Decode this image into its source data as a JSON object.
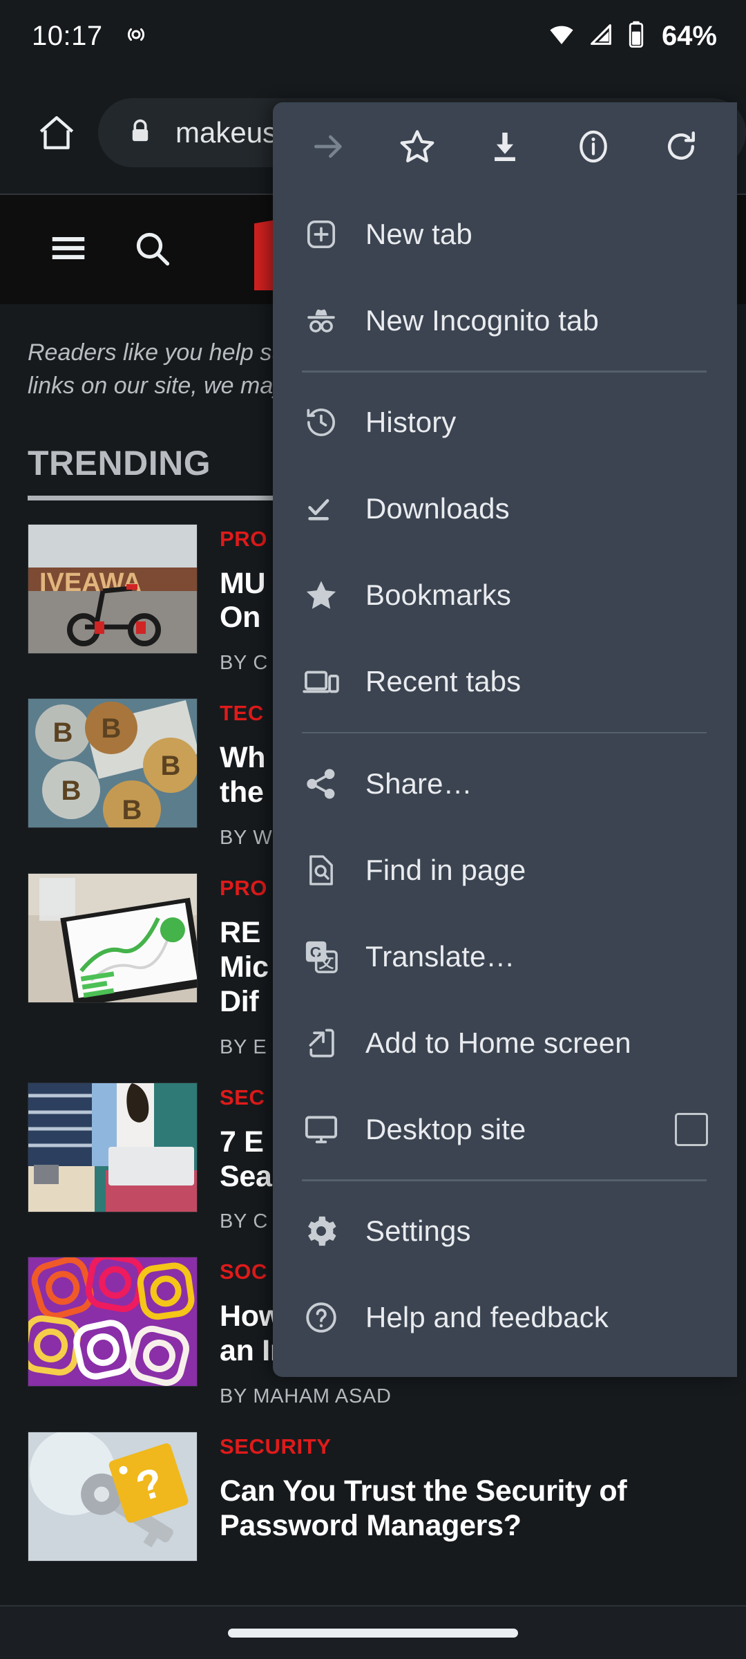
{
  "status_bar": {
    "time": "10:17",
    "hotspot_icon": "cast-hotspot-icon",
    "wifi_icon": "wifi-icon",
    "signal_icon": "cellular-signal-icon",
    "battery_icon": "battery-icon",
    "battery_percent": "64%"
  },
  "toolbar": {
    "home_icon": "home-icon",
    "lock_icon": "lock-icon",
    "url": "makeus"
  },
  "site_header": {
    "menu_icon": "hamburger-menu-icon",
    "search_icon": "search-icon",
    "logo": "makeuseof-logo"
  },
  "page": {
    "disclaimer_line1": "Readers like you help sup",
    "disclaimer_line2": "links on our site, we may",
    "trending_title": "TRENDING",
    "articles": [
      {
        "category": "PRO",
        "headline_line1": "MU",
        "headline_line2": "On",
        "byline": "BY C",
        "thumb": "electric-scooter-giveaway"
      },
      {
        "category": "TEC",
        "headline_line1": "Wh",
        "headline_line2": "the",
        "byline": "BY W",
        "thumb": "bitcoin-coins-cash"
      },
      {
        "category": "PRO",
        "headline_line1": "RE",
        "headline_line2": "Mic",
        "headline_line3": "Dif",
        "byline": "BY E",
        "thumb": "tablet-spreadsheet-chart"
      },
      {
        "category": "SEC",
        "headline_line1": "7 E",
        "headline_line2": "Sea",
        "byline": "BY C",
        "thumb": "people-with-laptop"
      },
      {
        "category": "SOC",
        "headline_line1": "How to Delete a Single Image From",
        "headline_line2": "an Instagram Carousel",
        "byline": "BY MAHAM ASAD",
        "thumb": "instagram-logo-pattern"
      },
      {
        "category": "SECURITY",
        "headline_line1": "Can You Trust the Security of",
        "headline_line2": "Password Managers?",
        "byline": "",
        "thumb": "key-with-question-tag"
      }
    ]
  },
  "menu": {
    "top_actions": [
      {
        "name": "forward-arrow-icon",
        "label": "Forward",
        "disabled": true
      },
      {
        "name": "star-outline-icon",
        "label": "Bookmark",
        "disabled": false
      },
      {
        "name": "download-icon",
        "label": "Download",
        "disabled": false
      },
      {
        "name": "info-circle-icon",
        "label": "Page info",
        "disabled": false
      },
      {
        "name": "reload-icon",
        "label": "Reload",
        "disabled": false
      }
    ],
    "groups": [
      {
        "items": [
          {
            "label": "New tab",
            "icon": "new-tab-icon"
          },
          {
            "label": "New Incognito tab",
            "icon": "incognito-icon"
          }
        ]
      },
      {
        "items": [
          {
            "label": "History",
            "icon": "history-icon"
          },
          {
            "label": "Downloads",
            "icon": "downloads-icon"
          },
          {
            "label": "Bookmarks",
            "icon": "star-filled-icon"
          },
          {
            "label": "Recent tabs",
            "icon": "recent-tabs-icon"
          }
        ]
      },
      {
        "items": [
          {
            "label": "Share…",
            "icon": "share-icon"
          },
          {
            "label": "Find in page",
            "icon": "find-in-page-icon"
          },
          {
            "label": "Translate…",
            "icon": "google-translate-icon"
          },
          {
            "label": "Add to Home screen",
            "icon": "add-to-home-screen-icon"
          },
          {
            "label": "Desktop site",
            "icon": "desktop-monitor-icon",
            "checkbox": false
          }
        ]
      },
      {
        "items": [
          {
            "label": "Settings",
            "icon": "gear-icon"
          },
          {
            "label": "Help and feedback",
            "icon": "help-circle-icon"
          }
        ]
      }
    ]
  },
  "navigation_bar": {
    "gesture_pill": "home-gesture-pill"
  },
  "colors": {
    "menu_bg": "#3b4450",
    "page_bg": "#161a1d",
    "accent_red": "#e01a1a",
    "text_primary": "#e9ebef"
  }
}
